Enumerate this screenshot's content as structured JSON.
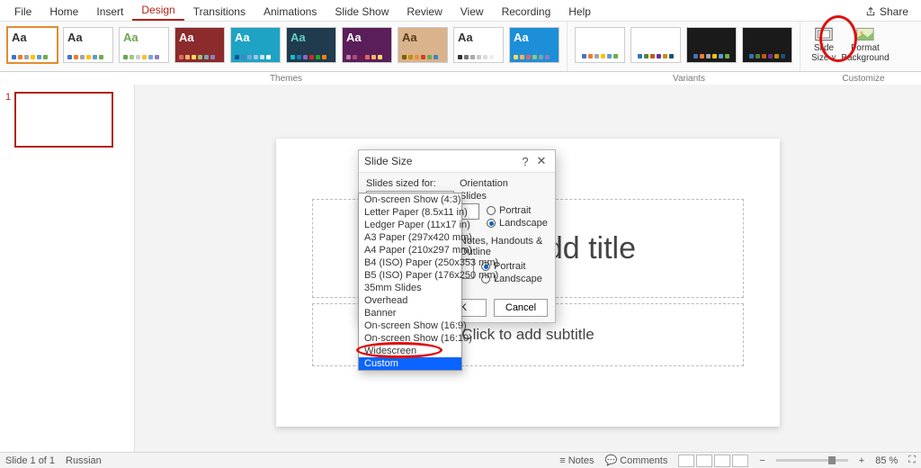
{
  "tabs": [
    "File",
    "Home",
    "Insert",
    "Design",
    "Transitions",
    "Animations",
    "Slide Show",
    "Review",
    "View",
    "Recording",
    "Help"
  ],
  "active_tab": "Design",
  "share": "Share",
  "ribbon_labels": {
    "themes": "Themes",
    "variants": "Variants",
    "customize": "Customize"
  },
  "customize": {
    "slide_size": "Slide\nSize ˅",
    "format_bg": "Format\nBackground"
  },
  "thumb_index": "1",
  "slide": {
    "title": "Click to add title",
    "subtitle": "Click to add subtitle"
  },
  "dialog": {
    "title": "Slide Size",
    "help": "?",
    "close": "✕",
    "sized_for_label": "Slides sized for:",
    "sized_for_value": "Widescreen",
    "orientation": "Orientation",
    "slides": "Slides",
    "portrait": "Portrait",
    "landscape": "Landscape",
    "notes": "Notes, Handouts & Outline",
    "ok": "OK",
    "cancel": "Cancel"
  },
  "dd_items": [
    "On-screen Show (4:3)",
    "Letter Paper (8.5x11 in)",
    "Ledger Paper (11x17 in)",
    "A3 Paper (297x420 mm)",
    "A4 Paper (210x297 mm)",
    "B4 (ISO) Paper (250x353 mm)",
    "B5 (ISO) Paper (176x250 mm)",
    "35mm Slides",
    "Overhead",
    "Banner",
    "On-screen Show (16:9)",
    "On-screen Show (16:10)",
    "Widescreen",
    "Custom"
  ],
  "dd_highlight": "Custom",
  "status": {
    "slide": "Slide 1 of 1",
    "lang": "Russian",
    "notes": "Notes",
    "comments": "Comments",
    "zoom": "85 %",
    "minus": "−",
    "plus": "+"
  }
}
